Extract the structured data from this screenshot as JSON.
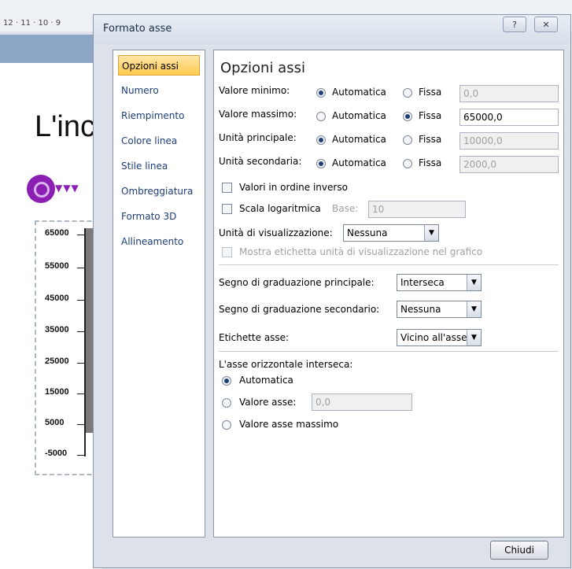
{
  "background": {
    "ruler_text": "12 · 11 · 10 · 9",
    "slide_title": "L'inc",
    "chart_ticks": [
      "65000",
      "55000",
      "45000",
      "35000",
      "25000",
      "15000",
      "5000",
      "-5000"
    ]
  },
  "dialog": {
    "title": "Formato asse",
    "help_label": "?",
    "close_label": "✕",
    "ok_label": "Chiudi"
  },
  "nav": {
    "items": [
      {
        "label": "Opzioni assi",
        "selected": true
      },
      {
        "label": "Numero"
      },
      {
        "label": "Riempimento"
      },
      {
        "label": "Colore linea"
      },
      {
        "label": "Stile linea"
      },
      {
        "label": "Ombreggiatura"
      },
      {
        "label": "Formato 3D"
      },
      {
        "label": "Allineamento"
      }
    ]
  },
  "panel": {
    "heading": "Opzioni assi",
    "auto_label": "Automatica",
    "fixed_label": "Fissa",
    "rows": {
      "min": {
        "label": "Valore minimo:",
        "value": "0,0",
        "mode": "auto"
      },
      "max": {
        "label": "Valore massimo:",
        "value": "65000,0",
        "mode": "fixed"
      },
      "major": {
        "label": "Unità principale:",
        "value": "10000,0",
        "mode": "auto"
      },
      "minor": {
        "label": "Unità secondaria:",
        "value": "2000,0",
        "mode": "auto"
      }
    },
    "reverse_label": "Valori in ordine inverso",
    "log_label": "Scala logaritmica",
    "base_label": "Base:",
    "base_value": "10",
    "display_units_label": "Unità di visualizzazione:",
    "display_units_value": "Nessuna",
    "show_units_label": "Mostra etichetta unità di visualizzazione nel grafico",
    "major_tick_label": "Segno di graduazione principale:",
    "major_tick_value": "Interseca",
    "minor_tick_label": "Segno di graduazione secondario:",
    "minor_tick_value": "Nessuna",
    "axis_labels_label": "Etichette asse:",
    "axis_labels_value": "Vicino all'asse",
    "cross_heading": "L'asse orizzontale interseca:",
    "cross_auto_label": "Automatica",
    "cross_value_label": "Valore asse:",
    "cross_value": "0,0",
    "cross_max_label": "Valore asse massimo"
  }
}
